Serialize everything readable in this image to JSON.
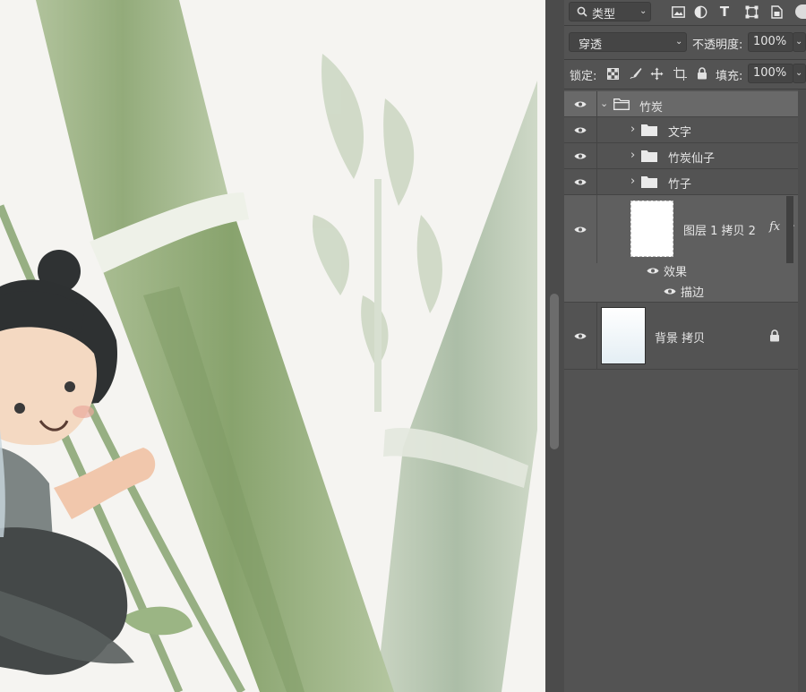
{
  "layers_panel": {
    "filter": {
      "label": "类型",
      "icon": "search-icon"
    },
    "filter_tools": [
      "image-filter-icon",
      "adjustment-filter-icon",
      "type-filter-icon",
      "shape-filter-icon",
      "smart-object-filter-icon"
    ],
    "blend_mode": "穿透",
    "opacity_label": "不透明度:",
    "opacity_value": "100%",
    "lock_label": "锁定:",
    "fill_label": "填充:",
    "fill_value": "100%",
    "layers": [
      {
        "name": "竹炭",
        "type": "group",
        "expanded": true
      },
      {
        "name": "文字",
        "type": "group",
        "expanded": false
      },
      {
        "name": "竹炭仙子",
        "type": "group",
        "expanded": false
      },
      {
        "name": "竹子",
        "type": "group",
        "expanded": false
      },
      {
        "name": "图层 1 拷贝 2",
        "type": "layer",
        "fx": "fx",
        "effects_label": "效果",
        "effect": "描边"
      },
      {
        "name": "背景 拷贝",
        "type": "layer",
        "locked": true
      }
    ]
  },
  "colors": {
    "panel_bg": "#535353",
    "selected_group": "#696969",
    "canvas_bg": "#f5f4f1"
  }
}
